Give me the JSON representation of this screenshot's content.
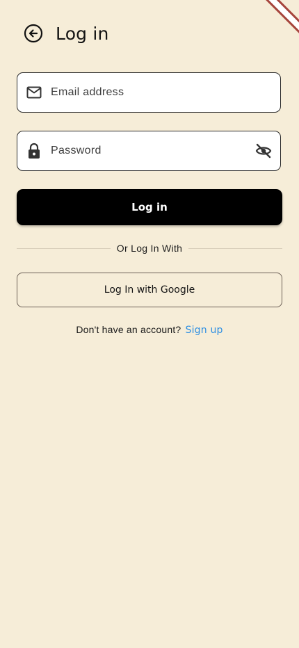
{
  "header": {
    "title": "Log in",
    "back_icon": "arrow-left-circle-icon"
  },
  "email_field": {
    "placeholder": "Email address",
    "value": "",
    "icon": "mail-icon"
  },
  "password_field": {
    "placeholder": "Password",
    "value": "",
    "icon": "lock-icon",
    "toggle_icon": "eye-off-icon"
  },
  "login_button": {
    "label": "Log in"
  },
  "divider": {
    "text": "Or Log In With"
  },
  "google_button": {
    "label": "Log In with Google"
  },
  "signup": {
    "prompt": "Don't have an account?",
    "link": "Sign up"
  },
  "colors": {
    "background": "#F6EDD8",
    "primary_button": "#000000",
    "link": "#2D8FE3",
    "field_bg": "#FFFFFF"
  }
}
